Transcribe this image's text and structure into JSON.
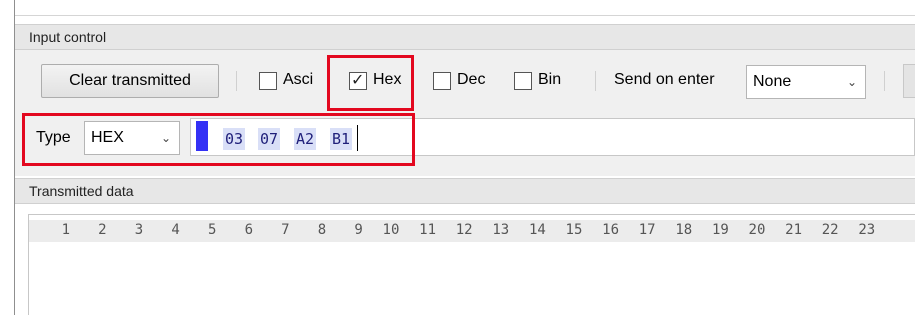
{
  "input_control": {
    "title": "Input control",
    "clear_button": "Clear transmitted",
    "checkboxes": [
      {
        "label": "Ascii",
        "checked": false
      },
      {
        "label": "Hex",
        "checked": true
      },
      {
        "label": "Dec",
        "checked": false
      },
      {
        "label": "Bin",
        "checked": false
      }
    ],
    "send_on_enter_label": "Send on enter",
    "send_on_enter_value": "None",
    "type_label": "Type",
    "type_value": "HEX",
    "hex_bytes": [
      "03",
      "07",
      "A2",
      "B1"
    ]
  },
  "transmitted_data": {
    "title": "Transmitted data",
    "columns": [
      "1",
      "2",
      "3",
      "4",
      "5",
      "6",
      "7",
      "8",
      "9",
      "10",
      "11",
      "12",
      "13",
      "14",
      "15",
      "16",
      "17",
      "18",
      "19",
      "20",
      "21",
      "22",
      "23"
    ]
  },
  "colors": {
    "highlight": "#e3081f",
    "caret": "#3431f5",
    "byte_background": "#d9dff7"
  }
}
